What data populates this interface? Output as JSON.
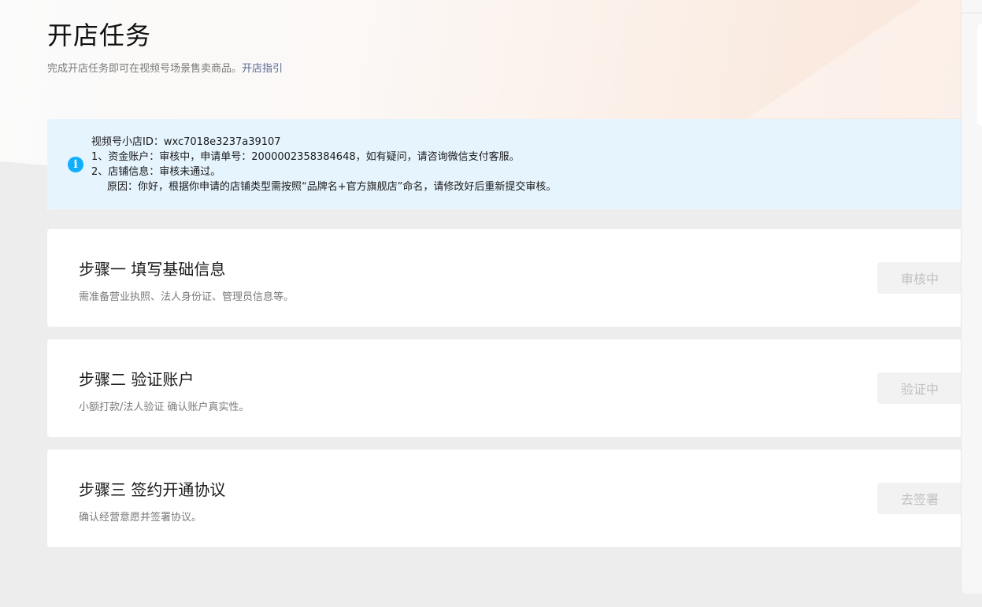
{
  "header": {
    "title": "开店任务",
    "subtitle": "完成开店任务即可在视频号场景售卖商品。",
    "guide_link": "开店指引"
  },
  "notice": {
    "icon": "info-icon",
    "lines": [
      "视频号小店ID：wxc7018e3237a39107",
      "1、资金账户：审核中，申请单号：2000002358384648，如有疑问，请咨询微信支付客服。",
      "2、店铺信息：审核未通过。",
      "原因：你好，根据你申请的店铺类型需按照“品牌名+官方旗舰店”命名，请修改好后重新提交审核。"
    ]
  },
  "steps": [
    {
      "title": "步骤一 填写基础信息",
      "description": "需准备营业执照、法人身份证、管理员信息等。",
      "button": "审核中"
    },
    {
      "title": "步骤二 验证账户",
      "description": "小额打款/法人验证 确认账户真实性。",
      "button": "验证中"
    },
    {
      "title": "步骤三 签约开通协议",
      "description": "确认经营意愿并签署协议。",
      "button": "去签署"
    }
  ],
  "colors": {
    "link": "#576b95",
    "info_icon": "#10aeff",
    "notice_bg": "#e6f4fd",
    "page_bg": "#ededed"
  }
}
